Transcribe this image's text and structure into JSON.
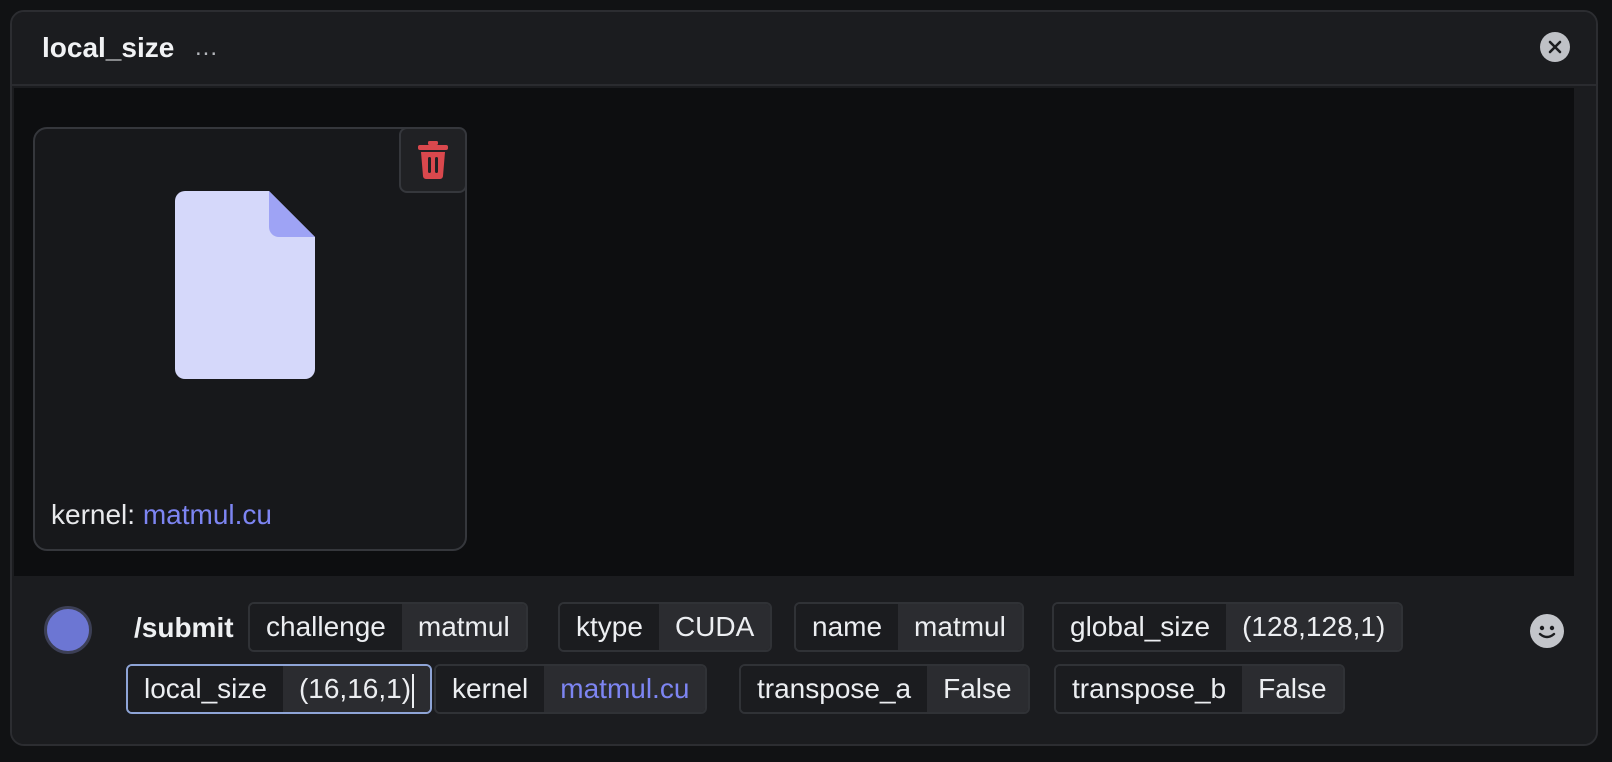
{
  "header": {
    "title": "local_size",
    "ellipsis": "..."
  },
  "icons": {
    "close": "close-icon",
    "delete": "trash-icon",
    "file": "file-icon",
    "emoji": "emoji-icon"
  },
  "colors": {
    "accent": "#7d85f2",
    "danger": "#d9484d",
    "file": "#d5d8fa",
    "file_fold": "#9ea3f5"
  },
  "attachment": {
    "caption_label": "kernel:",
    "filename": "matmul.cu"
  },
  "composer": {
    "command": "/submit",
    "options": [
      {
        "key": "challenge",
        "value": "matmul"
      },
      {
        "key": "ktype",
        "value": "CUDA"
      },
      {
        "key": "name",
        "value": "matmul"
      },
      {
        "key": "global_size",
        "value": "(128,128,1)"
      },
      {
        "key": "local_size",
        "value": "(16,16,1)"
      },
      {
        "key": "kernel",
        "value": "matmul.cu"
      },
      {
        "key": "transpose_a",
        "value": "False"
      },
      {
        "key": "transpose_b",
        "value": "False"
      }
    ]
  }
}
